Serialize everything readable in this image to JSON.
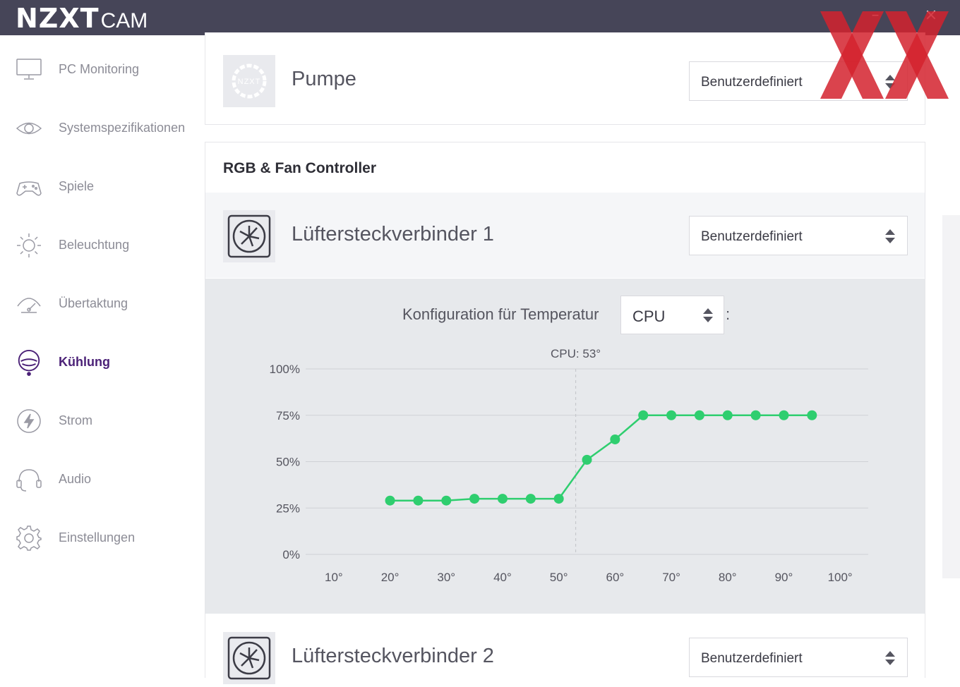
{
  "app": {
    "logo_text": "NZXT",
    "product_text": "CAM",
    "minimize_glyph": "–",
    "close_glyph": "×"
  },
  "sidebar": {
    "items": [
      {
        "label": "PC Monitoring",
        "icon": "monitor-icon",
        "active": false
      },
      {
        "label": "Systemspezifikationen",
        "icon": "eye-icon",
        "active": false
      },
      {
        "label": "Spiele",
        "icon": "gamepad-icon",
        "active": false
      },
      {
        "label": "Beleuchtung",
        "icon": "sun-icon",
        "active": false
      },
      {
        "label": "Übertaktung",
        "icon": "speedometer-icon",
        "active": false
      },
      {
        "label": "Kühlung",
        "icon": "cooling-icon",
        "active": true
      },
      {
        "label": "Strom",
        "icon": "lightning-icon",
        "active": false
      },
      {
        "label": "Audio",
        "icon": "headphones-icon",
        "active": false
      },
      {
        "label": "Einstellungen",
        "icon": "gear-icon",
        "active": false
      }
    ]
  },
  "pump": {
    "title": "Pumpe",
    "icon_text": "NZXT",
    "mode": "Benutzerdefiniert"
  },
  "rgb_fan": {
    "section_title": "RGB & Fan Controller",
    "fan1": {
      "title": "Lüftersteckverbinder 1",
      "mode": "Benutzerdefiniert"
    },
    "fan2": {
      "title": "Lüftersteckverbinder 2",
      "mode": "Benutzerdefiniert"
    },
    "temperature_label": "Konfiguration für Temperatur",
    "temperature_source": "CPU",
    "temperature_colon": ":"
  },
  "colors": {
    "titlebar": "#464558",
    "accent": "#4b2177",
    "curve": "#2fce6f",
    "watermark": "#d3222e"
  },
  "chart_data": {
    "type": "line",
    "x": [
      20,
      25,
      30,
      35,
      40,
      45,
      50,
      55,
      60,
      65,
      70,
      75,
      80,
      85,
      90,
      95
    ],
    "y": [
      29,
      29,
      29,
      30,
      30,
      30,
      30,
      51,
      62,
      75,
      75,
      75,
      75,
      75,
      75,
      75
    ],
    "x_ticks": [
      10,
      20,
      30,
      40,
      50,
      60,
      70,
      80,
      90,
      100
    ],
    "x_tick_labels": [
      "10°",
      "20°",
      "30°",
      "40°",
      "50°",
      "60°",
      "70°",
      "80°",
      "90°",
      "100°"
    ],
    "y_ticks": [
      0,
      25,
      50,
      75,
      100
    ],
    "y_tick_labels": [
      "0%",
      "25%",
      "50%",
      "75%",
      "100%"
    ],
    "xlim": [
      5,
      105
    ],
    "ylim": [
      0,
      100
    ],
    "grid": "horizontal",
    "marker_x": 53,
    "marker_label": "CPU: 53°"
  }
}
